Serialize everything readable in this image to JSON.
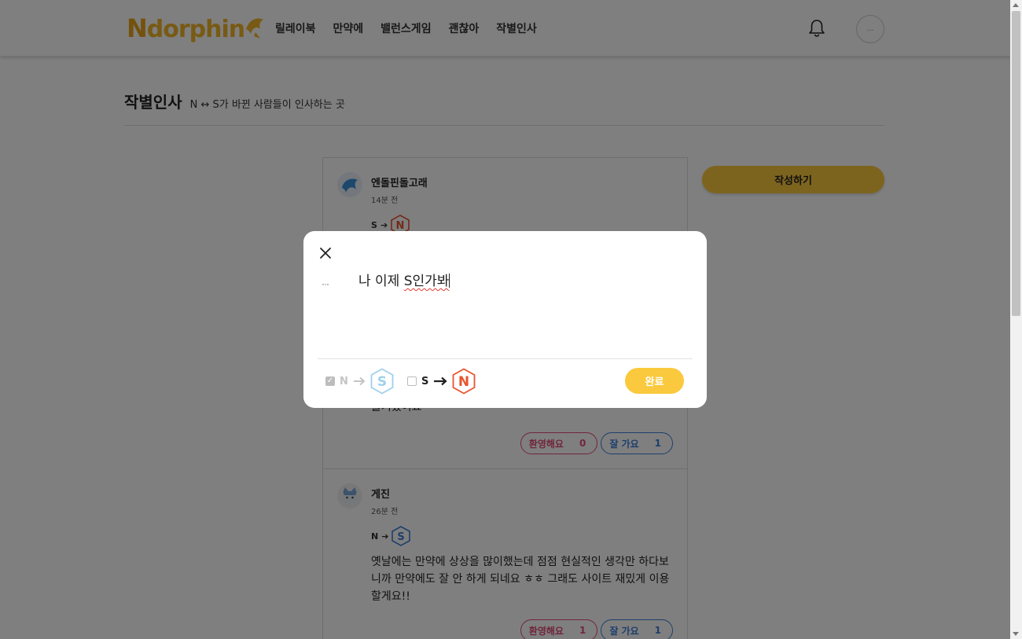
{
  "header": {
    "logo_text": "Ndorphin",
    "nav": [
      "릴레이북",
      "만약에",
      "밸런스게임",
      "괜찮아",
      "작별인사"
    ],
    "bell_icon": "bell-icon",
    "profile_icon": "profile-icon",
    "profile_placeholder": "..."
  },
  "page": {
    "title": "작별인사",
    "subtitle": "N ↔ S가 바뀐 사람들이 인사하는 곳",
    "write_button": "작성하기"
  },
  "posts": [
    {
      "author": "엔돌핀돌고래",
      "time": "14분 전",
      "from": "S",
      "to": "N",
      "body_visible": "즐거웠어요",
      "welcome_label": "환영해요",
      "welcome_count": "0",
      "bye_label": "잘 가요",
      "bye_count": "1"
    },
    {
      "author": "게진",
      "time": "26분 전",
      "from": "N",
      "to": "S",
      "body": "옛날에는 만약에 상상을 많이했는데 점점 현실적인 생각만 하다보니까 만약에도 잘 안 하게 되네요 ㅎㅎ 그래도 사이트 재밌게 이용할게요!!",
      "welcome_label": "환영해요",
      "welcome_count": "1",
      "bye_label": "잘 가요",
      "bye_count": "1"
    }
  ],
  "modal": {
    "text_prefix": "나 이제 ",
    "text_typed": "S인가봐",
    "option1_from": "N",
    "option1_to": "S",
    "option1_checked": true,
    "option2_from": "S",
    "option2_to": "N",
    "option2_checked": false,
    "done_label": "완료",
    "colors": {
      "accent": "#fbc93d",
      "n_badge": "#e8542f",
      "s_badge": "#3d7ed8",
      "s_badge_disabled": "#9fd0ee",
      "welcome": "#e04d7a",
      "bye": "#3d7ed8"
    }
  }
}
